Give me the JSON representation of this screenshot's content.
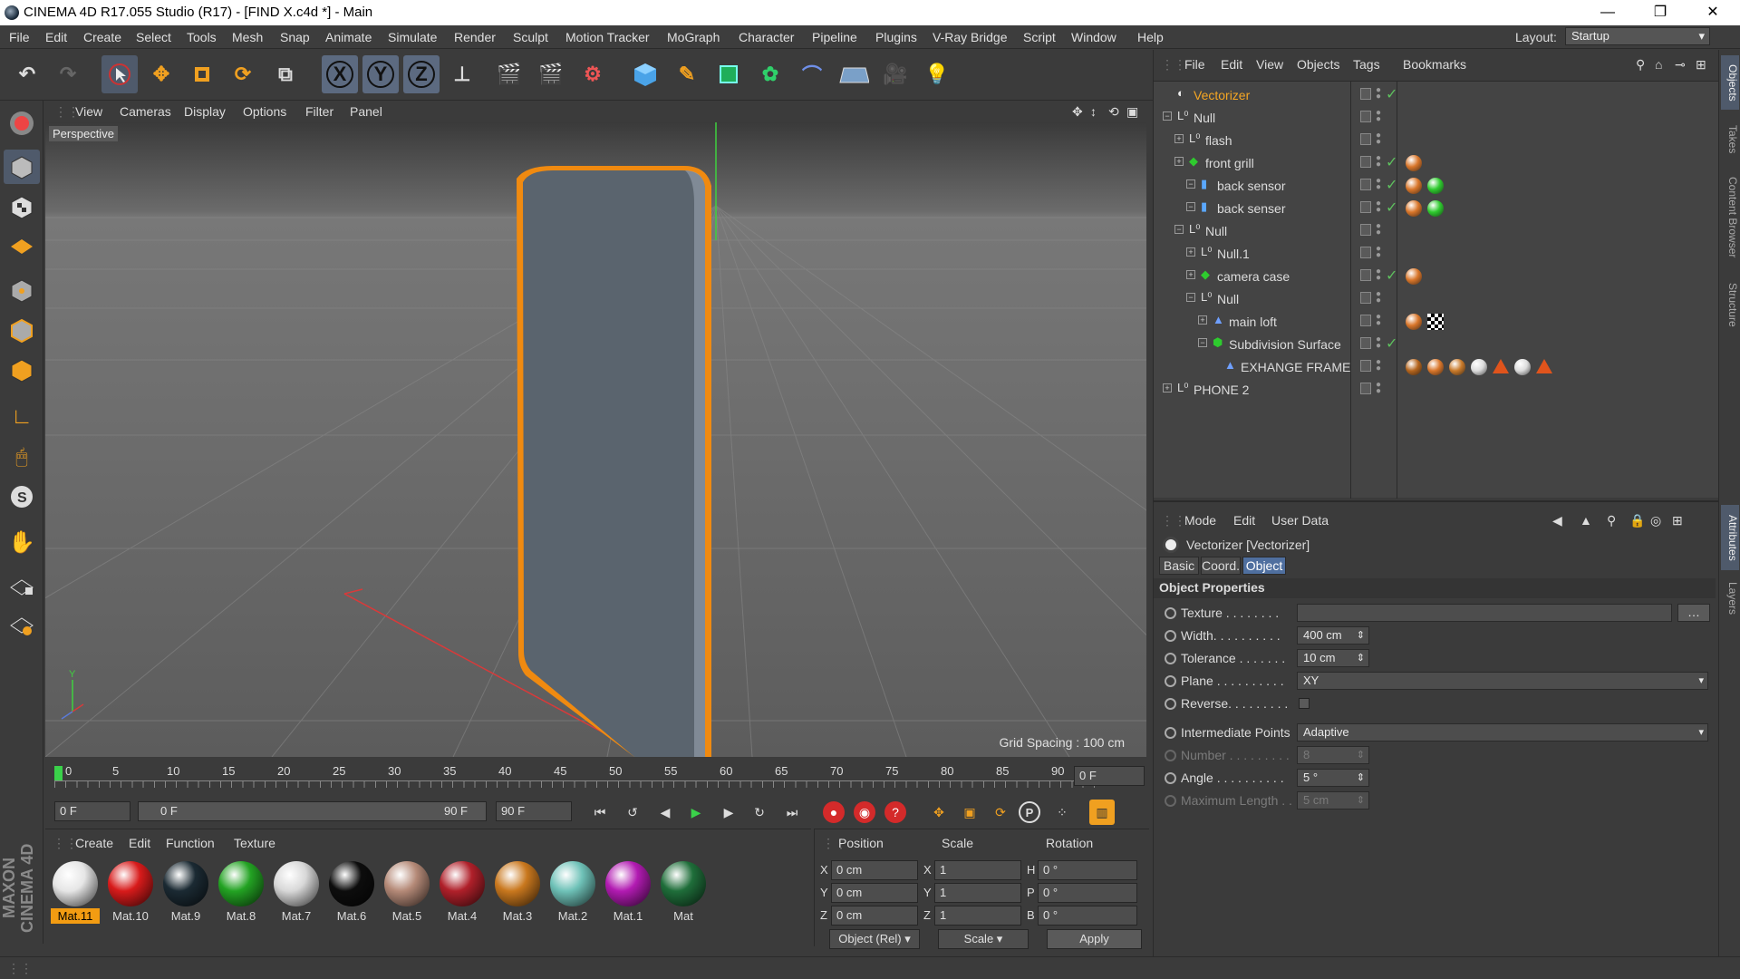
{
  "window": {
    "title": "CINEMA 4D R17.055 Studio (R17) - [FIND X.c4d *] - Main"
  },
  "menu": [
    "File",
    "Edit",
    "Create",
    "Select",
    "Tools",
    "Mesh",
    "Snap",
    "Animate",
    "Simulate",
    "Render",
    "Sculpt",
    "Motion Tracker",
    "MoGraph",
    "Character",
    "Pipeline",
    "Plugins",
    "V-Ray Bridge",
    "Script",
    "Window",
    "Help"
  ],
  "layout": {
    "label": "Layout:",
    "value": "Startup"
  },
  "viewport": {
    "menu": [
      "View",
      "Cameras",
      "Display",
      "Options",
      "Filter",
      "Panel"
    ],
    "camera": "Perspective",
    "grid_spacing": "Grid Spacing : 100 cm"
  },
  "timeline": {
    "ticks": [
      "0",
      "5",
      "10",
      "15",
      "20",
      "25",
      "30",
      "35",
      "40",
      "45",
      "50",
      "55",
      "60",
      "65",
      "70",
      "75",
      "80",
      "85",
      "90"
    ],
    "current_frame": "0 F",
    "start": "0 F",
    "range_start": "0 F",
    "range_end": "90 F",
    "end": "90 F"
  },
  "materials": {
    "menu": [
      "Create",
      "Edit",
      "Function",
      "Texture"
    ],
    "items": [
      {
        "name": "Mat.11",
        "color": "#e6e6e6"
      },
      {
        "name": "Mat.10",
        "color": "#d81b1b"
      },
      {
        "name": "Mat.9",
        "color": "#1b2a33"
      },
      {
        "name": "Mat.8",
        "color": "#23a323"
      },
      {
        "name": "Mat.7",
        "color": "#d8d8d8"
      },
      {
        "name": "Mat.6",
        "color": "#0d0d0d"
      },
      {
        "name": "Mat.5",
        "color": "#b58a78"
      },
      {
        "name": "Mat.4",
        "color": "#b0202a"
      },
      {
        "name": "Mat.3",
        "color": "#c9781e"
      },
      {
        "name": "Mat.2",
        "color": "#6fc2b8"
      },
      {
        "name": "Mat.1",
        "color": "#b21bb2"
      },
      {
        "name": "Mat",
        "color": "#1f6e3a"
      }
    ]
  },
  "coords": {
    "headers": [
      "Position",
      "Scale",
      "Rotation"
    ],
    "rows": [
      {
        "axis": "X",
        "pos": "0 cm",
        "saxis": "X",
        "scale": "1",
        "raxis": "H",
        "rot": "0 °"
      },
      {
        "axis": "Y",
        "pos": "0 cm",
        "saxis": "Y",
        "scale": "1",
        "raxis": "P",
        "rot": "0 °"
      },
      {
        "axis": "Z",
        "pos": "0 cm",
        "saxis": "Z",
        "scale": "1",
        "raxis": "B",
        "rot": "0 °"
      }
    ],
    "mode": "Object (Rel)",
    "scale_mode": "Scale",
    "apply": "Apply"
  },
  "objects": {
    "menu": [
      "File",
      "Edit",
      "View",
      "Objects",
      "Tags",
      "Bookmarks"
    ],
    "tree": [
      {
        "name": "Vectorizer",
        "indent": 0,
        "selected": true,
        "check": true
      },
      {
        "name": "Null",
        "indent": 0,
        "check": false
      },
      {
        "name": "flash",
        "indent": 1,
        "check": false
      },
      {
        "name": "front grill",
        "indent": 1,
        "check": true
      },
      {
        "name": "back sensor",
        "indent": 2,
        "check": true
      },
      {
        "name": "back senser",
        "indent": 2,
        "check": true
      },
      {
        "name": "Null",
        "indent": 1,
        "check": false
      },
      {
        "name": "Null.1",
        "indent": 2,
        "check": false
      },
      {
        "name": "camera case",
        "indent": 2,
        "check": true
      },
      {
        "name": "Null",
        "indent": 2,
        "check": false
      },
      {
        "name": "main loft",
        "indent": 3,
        "check": false
      },
      {
        "name": "Subdivision Surface",
        "indent": 3,
        "check": true
      },
      {
        "name": "EXHANGE FRAME",
        "indent": 4,
        "check": false
      },
      {
        "name": "PHONE 2",
        "indent": 0,
        "check": false
      }
    ]
  },
  "attributes": {
    "menu": [
      "Mode",
      "Edit",
      "User Data"
    ],
    "object_title": "Vectorizer [Vectorizer]",
    "tabs": [
      "Basic",
      "Coord.",
      "Object"
    ],
    "section": "Object Properties",
    "fields": [
      {
        "label": "Texture . . . . . . . .",
        "value": ""
      },
      {
        "label": "Width. . . . . . . . . .",
        "value": "400 cm"
      },
      {
        "label": "Tolerance . . . . . . .",
        "value": "10 cm"
      },
      {
        "label": "Plane . . . . . . . . . .",
        "value": "XY"
      },
      {
        "label": "Reverse. . . . . . . . .",
        "value": ""
      },
      {
        "label": "Intermediate Points",
        "value": "Adaptive"
      },
      {
        "label": "Number . . . . . . . . .",
        "value": "8"
      },
      {
        "label": "Angle . . . . . . . . . .",
        "value": "5 °"
      },
      {
        "label": "Maximum Length . .",
        "value": "5 cm"
      }
    ]
  },
  "side_tabs": [
    "Objects",
    "Takes",
    "Content Browser",
    "Structure",
    "Attributes",
    "Layers"
  ],
  "brand": "MAXON CINEMA 4D"
}
